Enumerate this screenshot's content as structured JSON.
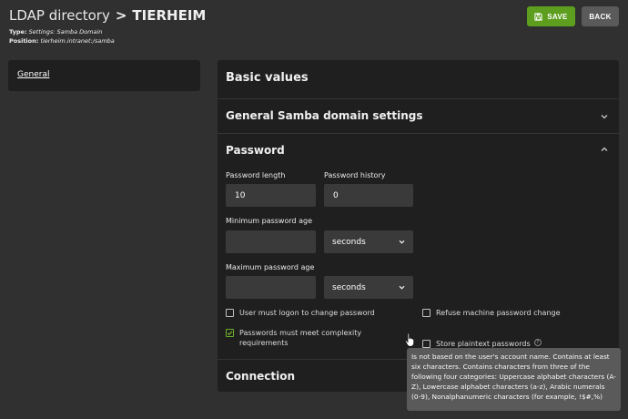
{
  "header": {
    "breadcrumb_root": "LDAP directory",
    "separator": ">",
    "current": "TIERHEIM",
    "type_label": "Type:",
    "type_value": "Settings: Samba Domain",
    "position_label": "Position:",
    "position_value": "tierheim.intranet:/samba"
  },
  "toolbar": {
    "save_label": "SAVE",
    "back_label": "BACK"
  },
  "sidebar": {
    "items": [
      {
        "label": "General"
      }
    ]
  },
  "panel": {
    "basic_title": "Basic values",
    "sections": {
      "general_samba": "General Samba domain settings",
      "password": "Password",
      "connection": "Connection"
    },
    "password": {
      "length_label": "Password length",
      "length_value": "10",
      "history_label": "Password history",
      "history_value": "0",
      "min_age_label": "Minimum password age",
      "min_age_value": "",
      "min_age_unit": "seconds",
      "max_age_label": "Maximum password age",
      "max_age_value": "",
      "max_age_unit": "seconds",
      "checkboxes": {
        "logon_change": {
          "label": "User must logon to change password",
          "checked": false
        },
        "refuse_machine": {
          "label": "Refuse machine password change",
          "checked": false
        },
        "complexity": {
          "label_line1": "Passwords must meet complexity",
          "label_line2": "requirements",
          "checked": true
        },
        "store_plaintext": {
          "label": "Store plaintext passwords",
          "checked": false
        }
      }
    }
  },
  "tooltip": {
    "text": "Is not based on the user's account name. Contains at least six characters. Contains characters from three of the following four categories: Uppercase alphabet characters (A-Z), Lowercase alphabet characters (a-z), Arabic numerals (0-9), Nonalphanumeric characters (for example, !$#,%)"
  },
  "colors": {
    "accent_green": "#5d9e1f",
    "panel_bg": "#1f1f1f",
    "page_bg": "#303030"
  }
}
